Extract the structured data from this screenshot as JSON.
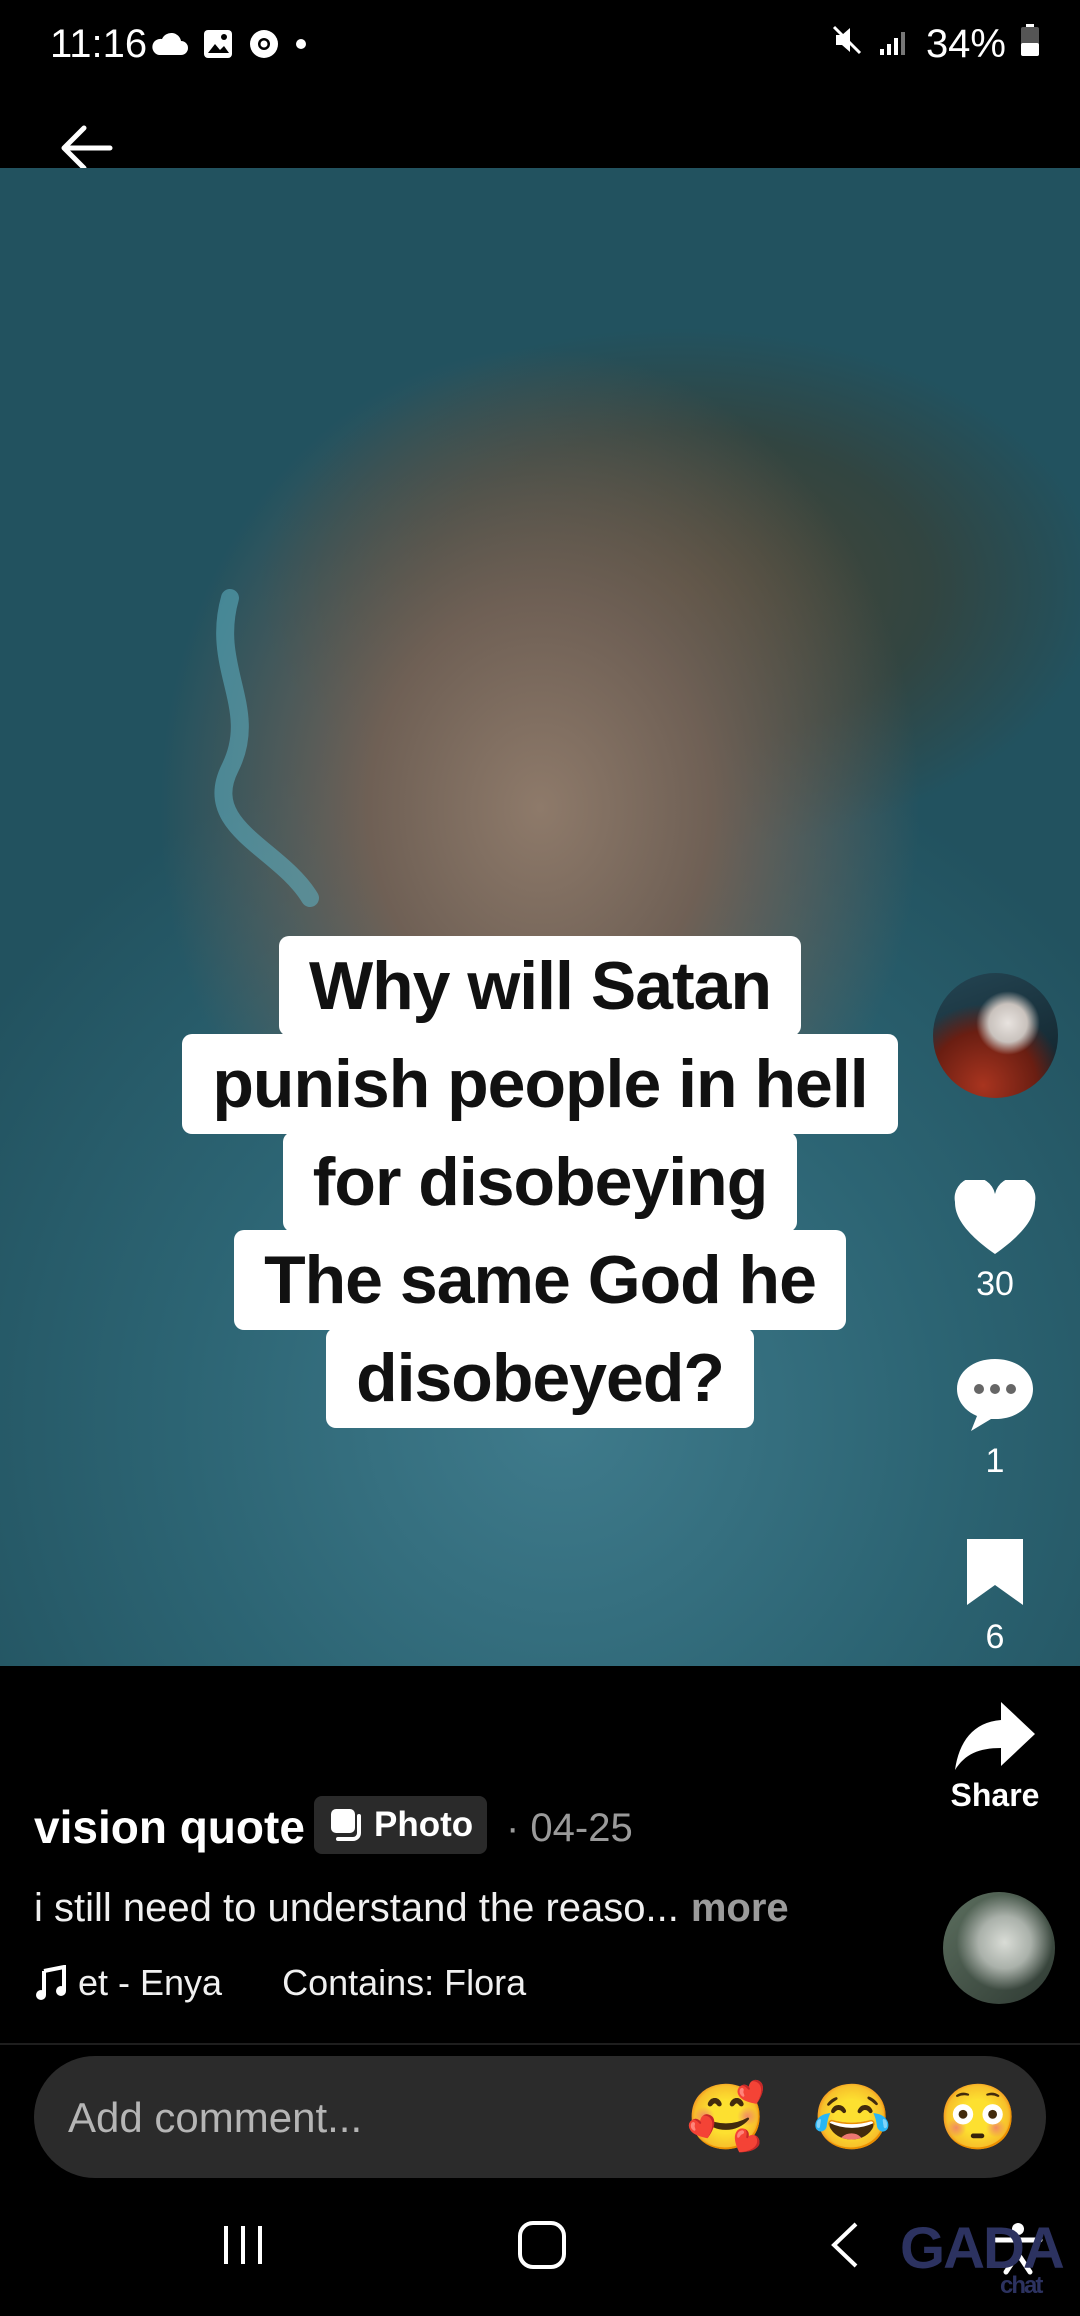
{
  "status_bar": {
    "time": "11:16",
    "battery": "34%",
    "left_icons": [
      "cloud-icon",
      "gallery-icon",
      "chrome-icon",
      "dot-icon"
    ],
    "right_icons": [
      "mute-icon",
      "signal-icon",
      "battery-icon"
    ]
  },
  "post": {
    "caption_lines": [
      "Why will Satan",
      "punish people in hell",
      "for disobeying",
      "The same God he",
      "disobeyed?"
    ],
    "username": "vision quote",
    "type_badge": "Photo",
    "date": "· 04-25",
    "description": "i still need to understand the reaso...",
    "more_label": "more",
    "music": "et - Enya",
    "contains": "Contains: Flora"
  },
  "actions": {
    "likes": "30",
    "comments": "1",
    "saves": "6",
    "share_label": "Share"
  },
  "comment_bar": {
    "placeholder": "Add comment...",
    "emojis": [
      "🥰",
      "😂",
      "😳"
    ]
  },
  "watermark": {
    "text": "GADA",
    "sub": "chat"
  },
  "colors": {
    "background": "#000000",
    "caption_box": "#ffffff",
    "comment_bar": "#2b2b2b",
    "muted_text": "#9a9a9a"
  }
}
